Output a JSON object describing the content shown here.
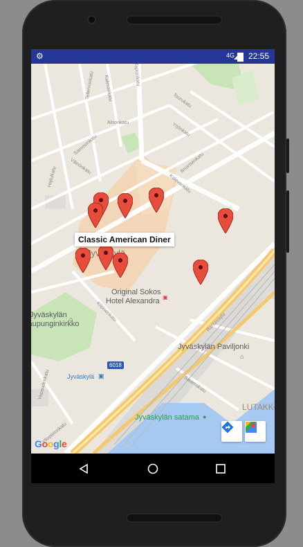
{
  "status_bar": {
    "time": "22:55",
    "network": "4G"
  },
  "map": {
    "info_window_title": "Classic American Diner",
    "google_logo": "Google",
    "road_number": "6018",
    "streets": [
      "Tellervonkatu",
      "Kalevankatu",
      "Tapionkatu",
      "Alnonkatu",
      "Tourukatu",
      "Yrjönkatu",
      "Sammonkatu",
      "Väinönkatu",
      "Hajlulkatu",
      "Ilmarisenkatu",
      "Kalevankatu",
      "Kilpisenkatu",
      "Rantavayla",
      "Satamakatu",
      "Vapaudenkatu",
      "Yliopistonkatu"
    ],
    "labels": {
      "center": "Jyväskylä",
      "hotel_line1": "Original Sokos",
      "hotel_line2": "Hotel Alexandra",
      "church_line1": "Jyväskylän",
      "church_line2": "kaupunginkirkko",
      "pavilion": "Jyväskylän Paviljonki",
      "station": "Jyväskylä",
      "harbour": "Jyväskylän satama",
      "district": "LUTAKKO"
    },
    "marker_count": 9,
    "colors": {
      "marker": "#e74c3c",
      "water": "#a6c9f2",
      "park": "#c8e4b8",
      "road_major": "#f5c86b"
    }
  },
  "buttons": {
    "directions": "directions-icon",
    "open_maps": "google-maps-icon"
  },
  "navbar": {
    "back": "back-icon",
    "home": "home-icon",
    "recents": "recents-icon"
  }
}
